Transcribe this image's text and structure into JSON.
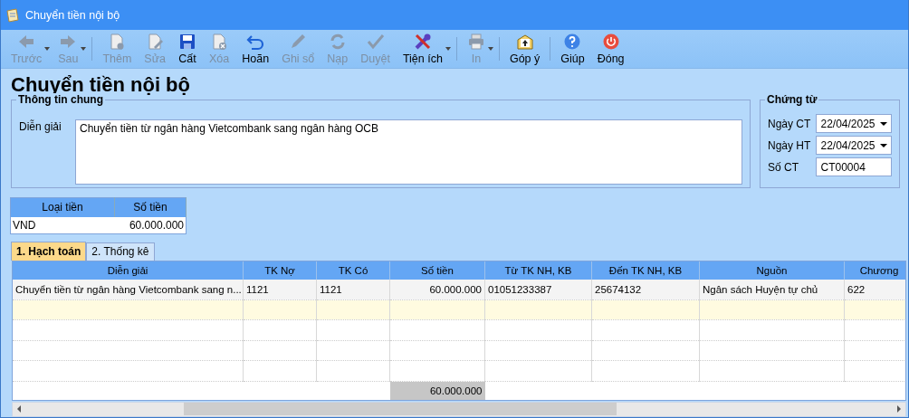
{
  "window": {
    "title": "Chuyển tiền nội bộ"
  },
  "toolbar": [
    {
      "label": "Trước",
      "disabled": true,
      "dropdown": true,
      "separator_after": false
    },
    {
      "label": "Sau",
      "disabled": true,
      "dropdown": true,
      "separator_after": true
    },
    {
      "label": "Thêm",
      "disabled": true,
      "dropdown": false,
      "separator_after": false
    },
    {
      "label": "Sửa",
      "disabled": true,
      "dropdown": false,
      "separator_after": false
    },
    {
      "label": "Cất",
      "disabled": false,
      "dropdown": false,
      "separator_after": false
    },
    {
      "label": "Xóa",
      "disabled": true,
      "dropdown": false,
      "separator_after": false
    },
    {
      "label": "Hoãn",
      "disabled": false,
      "dropdown": false,
      "separator_after": false
    },
    {
      "label": "Ghi sổ",
      "disabled": true,
      "dropdown": false,
      "separator_after": false
    },
    {
      "label": "Nạp",
      "disabled": true,
      "dropdown": false,
      "separator_after": false
    },
    {
      "label": "Duyệt",
      "disabled": true,
      "dropdown": false,
      "separator_after": false
    },
    {
      "label": "Tiện ích",
      "disabled": false,
      "dropdown": true,
      "separator_after": true
    },
    {
      "label": "In",
      "disabled": true,
      "dropdown": true,
      "separator_after": true
    },
    {
      "label": "Góp ý",
      "disabled": false,
      "dropdown": false,
      "separator_after": true
    },
    {
      "label": "Giúp",
      "disabled": false,
      "dropdown": false,
      "separator_after": false
    },
    {
      "label": "Đóng",
      "disabled": false,
      "dropdown": false,
      "separator_after": false
    }
  ],
  "heading": "Chuyển tiền nội bộ",
  "general": {
    "title": "Thông tin chung",
    "label": "Diễn giải",
    "value": "Chuyển tiền từ ngân hàng Vietcombank sang ngân hàng OCB"
  },
  "voucher": {
    "title": "Chứng từ",
    "fields": [
      {
        "kind": "date",
        "label": "Ngày CT",
        "value": "22/04/2025"
      },
      {
        "kind": "date",
        "label": "Ngày HT",
        "value": "22/04/2025"
      },
      {
        "kind": "text",
        "label": "Số CT",
        "value": "CT00004"
      }
    ]
  },
  "currency_table": {
    "columns": [
      "Loại tiền",
      "Số tiền"
    ],
    "rows": [
      [
        "VND",
        "60.000.000"
      ]
    ]
  },
  "tabs": [
    {
      "label": "1. Hạch toán",
      "selected": true
    },
    {
      "label": "2. Thống kê",
      "selected": false
    }
  ],
  "grid": {
    "columns": [
      {
        "label": "Diễn giải",
        "kind": "text"
      },
      {
        "label": "TK Nợ",
        "kind": "text"
      },
      {
        "label": "TK Có",
        "kind": "text"
      },
      {
        "label": "Số tiền",
        "kind": "amount"
      },
      {
        "label": "Từ TK NH, KB",
        "kind": "text"
      },
      {
        "label": "Đến TK NH, KB",
        "kind": "text"
      },
      {
        "label": "Nguồn",
        "kind": "text"
      },
      {
        "label": "Chương",
        "kind": "text"
      }
    ],
    "rows": [
      [
        "Chuyển tiền từ ngân hàng Vietcombank sang n...",
        "1121",
        "1121",
        "60.000.000",
        "01051233387",
        "25674132",
        "Ngân sách Huyện tự chủ",
        "622"
      ]
    ],
    "total": "60.000.000"
  }
}
